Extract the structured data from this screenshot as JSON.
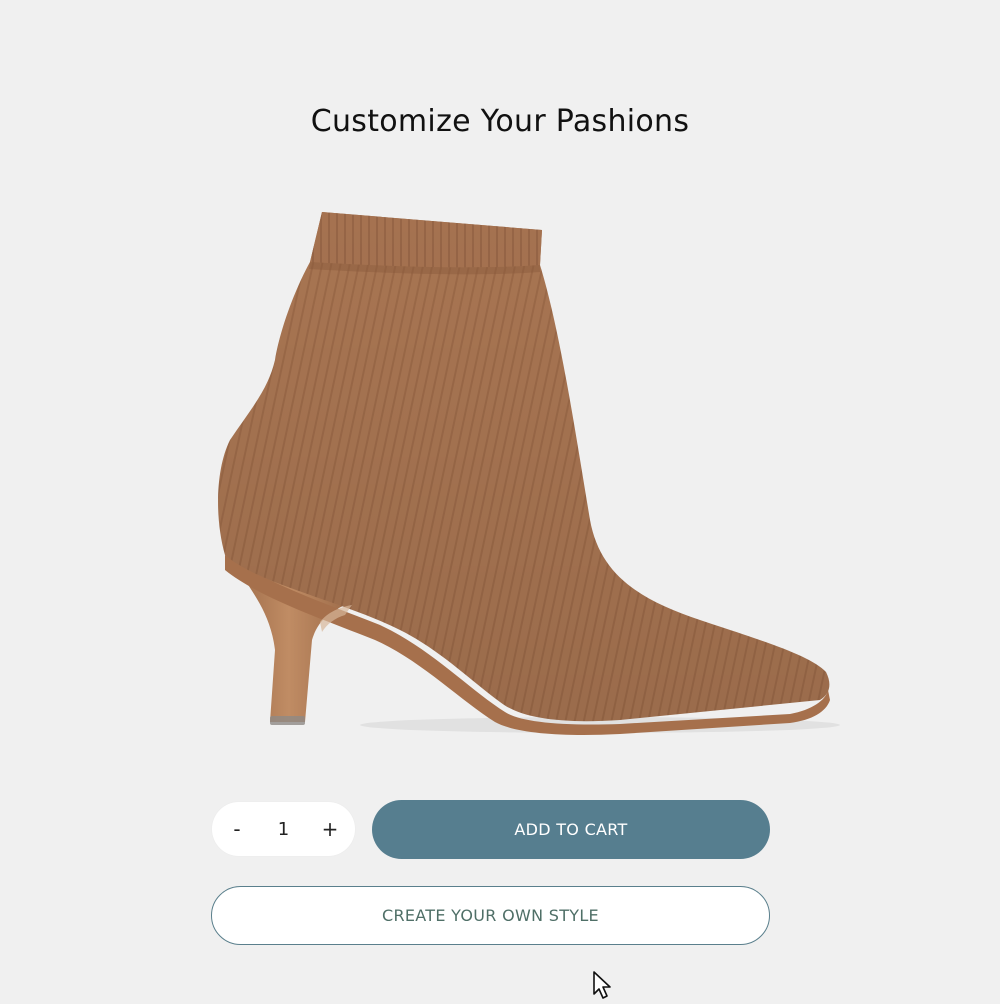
{
  "header": {
    "title": "Customize Your Pashions"
  },
  "product": {
    "image_icon": "ankle-boot-image",
    "boot_color": "#a87552",
    "heel_color": "#b07d57"
  },
  "quantity": {
    "decrement_label": "-",
    "value": "1",
    "increment_label": "+"
  },
  "actions": {
    "add_to_cart_label": "ADD TO CART",
    "create_style_label": "CREATE YOUR OWN STYLE",
    "primary_color": "#567e8f"
  },
  "pointer": {
    "icon": "mouse-cursor-icon"
  }
}
